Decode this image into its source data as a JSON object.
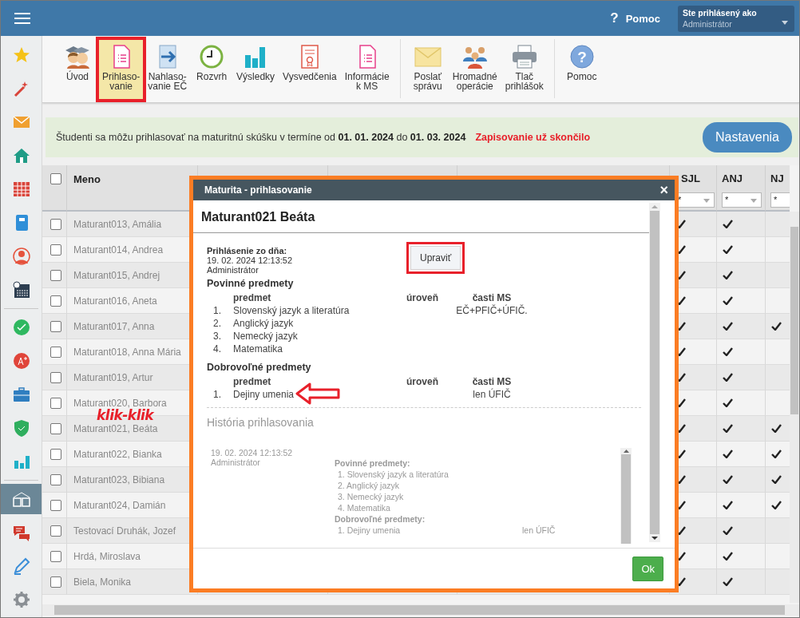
{
  "top_bar": {
    "help_icon": "?",
    "help": "Pomoc",
    "user_label": "Ste prihlásený ako",
    "user": "Administrátor"
  },
  "sidebar": {
    "groups": [
      [
        {
          "kind": "star",
          "selected": false
        },
        {
          "kind": "wand",
          "selected": false
        },
        {
          "kind": "mail",
          "selected": false
        },
        {
          "kind": "home",
          "selected": false
        },
        {
          "kind": "grid",
          "selected": false
        },
        {
          "kind": "notebook",
          "selected": false
        },
        {
          "kind": "person",
          "selected": false
        },
        {
          "kind": "schedule",
          "selected": false
        }
      ],
      [
        {
          "kind": "check",
          "selected": false
        },
        {
          "kind": "grade",
          "selected": false
        },
        {
          "kind": "briefcase",
          "selected": false
        },
        {
          "kind": "shield",
          "selected": false
        },
        {
          "kind": "bars",
          "selected": false
        }
      ],
      [
        {
          "kind": "book",
          "selected": true
        },
        {
          "kind": "chat",
          "selected": false
        },
        {
          "kind": "pen",
          "selected": false
        },
        {
          "kind": "gear",
          "selected": false
        }
      ]
    ]
  },
  "toolbar": {
    "groups": [
      [
        {
          "kind": "students",
          "lines": [
            "Úvod"
          ],
          "selected": false,
          "highlighted": false
        },
        {
          "kind": "list-doc",
          "lines": [
            "Prihlaso-",
            "vanie"
          ],
          "selected": true,
          "highlighted": true
        },
        {
          "kind": "arrow-doc",
          "lines": [
            "Nahlaso-",
            "vanie EČ"
          ],
          "selected": false,
          "highlighted": false
        },
        {
          "kind": "clock",
          "lines": [
            "Rozvrh"
          ],
          "selected": false,
          "highlighted": false
        },
        {
          "kind": "bars",
          "lines": [
            "Výsledky"
          ],
          "selected": false,
          "highlighted": false
        },
        {
          "kind": "certificate",
          "lines": [
            "Vysvedčenia"
          ],
          "selected": false,
          "highlighted": false
        },
        {
          "kind": "list-doc",
          "lines": [
            "Informácie",
            "k MS"
          ],
          "selected": false,
          "highlighted": false
        }
      ],
      [
        {
          "kind": "envelope",
          "lines": [
            "Poslať",
            "správu"
          ],
          "selected": false,
          "highlighted": false
        },
        {
          "kind": "people",
          "lines": [
            "Hromadné",
            "operácie"
          ],
          "selected": false,
          "highlighted": false
        },
        {
          "kind": "printer",
          "lines": [
            "Tlač",
            "prihlášok"
          ],
          "selected": false,
          "highlighted": false
        }
      ],
      [
        {
          "kind": "help",
          "icon_text": "?",
          "lines": [
            "Pomoc"
          ],
          "selected": false,
          "highlighted": false
        }
      ]
    ]
  },
  "notice": {
    "text": "Študenti sa môžu prihlasovať na maturitnú skúšku v termíne od **01. 01. 2024** do **01. 03. 2024**",
    "status": "Zapisovanie už skončilo",
    "button": "Nastavenia"
  },
  "table": {
    "all_checked": false,
    "name_column": "Meno",
    "subject_columns": [
      {
        "label": "SJL",
        "filter": "*"
      },
      {
        "label": "ANJ",
        "filter": "*"
      },
      {
        "label": "NJ",
        "filter": "*"
      }
    ],
    "rows": [
      {
        "name": "Maturant013, Amália",
        "checked": false,
        "subjects": [
          true,
          true,
          false
        ]
      },
      {
        "name": "Maturant014, Andrea",
        "checked": false,
        "subjects": [
          true,
          true,
          false
        ]
      },
      {
        "name": "Maturant015, Andrej",
        "checked": false,
        "subjects": [
          true,
          true,
          false
        ]
      },
      {
        "name": "Maturant016, Aneta",
        "checked": false,
        "subjects": [
          true,
          true,
          false
        ]
      },
      {
        "name": "Maturant017, Anna",
        "checked": false,
        "subjects": [
          true,
          true,
          true
        ]
      },
      {
        "name": "Maturant018, Anna Mária",
        "checked": false,
        "subjects": [
          true,
          true,
          false
        ]
      },
      {
        "name": "Maturant019, Artur",
        "checked": false,
        "subjects": [
          true,
          true,
          false
        ]
      },
      {
        "name": "Maturant020, Barbora",
        "checked": false,
        "subjects": [
          true,
          true,
          false
        ]
      },
      {
        "name": "Maturant021, Beáta",
        "checked": false,
        "subjects": [
          true,
          true,
          true
        ]
      },
      {
        "name": "Maturant022, Bianka",
        "checked": false,
        "subjects": [
          true,
          true,
          true
        ]
      },
      {
        "name": "Maturant023, Bibiana",
        "checked": false,
        "subjects": [
          true,
          true,
          true
        ]
      },
      {
        "name": "Maturant024, Damián",
        "checked": false,
        "subjects": [
          true,
          true,
          true
        ]
      },
      {
        "name": "Testovací Druhák, Jozef",
        "checked": false,
        "subjects": [
          true,
          true,
          false
        ]
      },
      {
        "name": "Hrdá, Miroslava",
        "checked": false,
        "subjects": [
          true,
          true,
          false
        ]
      },
      {
        "name": "Biela, Monika",
        "checked": false,
        "subjects": [
          true,
          true,
          false
        ]
      }
    ]
  },
  "annotation_note": "klik-klik",
  "dialog": {
    "title": "Maturita - prihlasovanie",
    "close": "×",
    "student": "Maturant021 Beáta",
    "registered_label": "Prihlásenie zo dňa:",
    "registered_date": "19. 02. 2024 12:13:52",
    "registered_by": "Administrátor",
    "edit_button": {
      "label": "Upraviť",
      "highlighted": true
    },
    "sections": [
      {
        "title": "Povinné predmety",
        "columns": [
          "predmet",
          "úroveň",
          "časti MS"
        ],
        "subjects": [
          {
            "number": "1.",
            "name": "Slovenský jazyk a literatúra",
            "parts": "EČ+PFIČ+ÚFIČ.",
            "marked": false
          },
          {
            "number": "2.",
            "name": "Anglický jazyk",
            "marked": false
          },
          {
            "number": "3.",
            "name": "Nemecký jazyk",
            "marked": false
          },
          {
            "number": "4.",
            "name": "Matematika",
            "marked": false
          }
        ]
      },
      {
        "title": "Dobrovoľné predmety",
        "columns": [
          "predmet",
          "úroveň",
          "časti MS"
        ],
        "subjects": [
          {
            "number": "1.",
            "name": "Dejiny umenia",
            "parts": "len ÚFIČ",
            "marked": true
          }
        ]
      }
    ],
    "history_title": "História prihlasovania",
    "history": [
      {
        "date": "19. 02. 2024 12:13:52",
        "by": "Administrátor",
        "lines": [
          {
            "kind": "heading",
            "text": "Povinné predmety:"
          },
          {
            "kind": "item",
            "text": "1. Slovenský jazyk a literatúra"
          },
          {
            "kind": "item",
            "text": "2. Anglický jazyk"
          },
          {
            "kind": "item",
            "text": "3. Nemecký jazyk"
          },
          {
            "kind": "item",
            "text": "4. Matematika"
          },
          {
            "kind": "heading",
            "text": "Dobrovoľné predmety:"
          },
          {
            "kind": "item",
            "text": "1. Dejiny umenia",
            "parts": "len ÚFIČ"
          }
        ]
      }
    ],
    "ok_button": "Ok"
  }
}
